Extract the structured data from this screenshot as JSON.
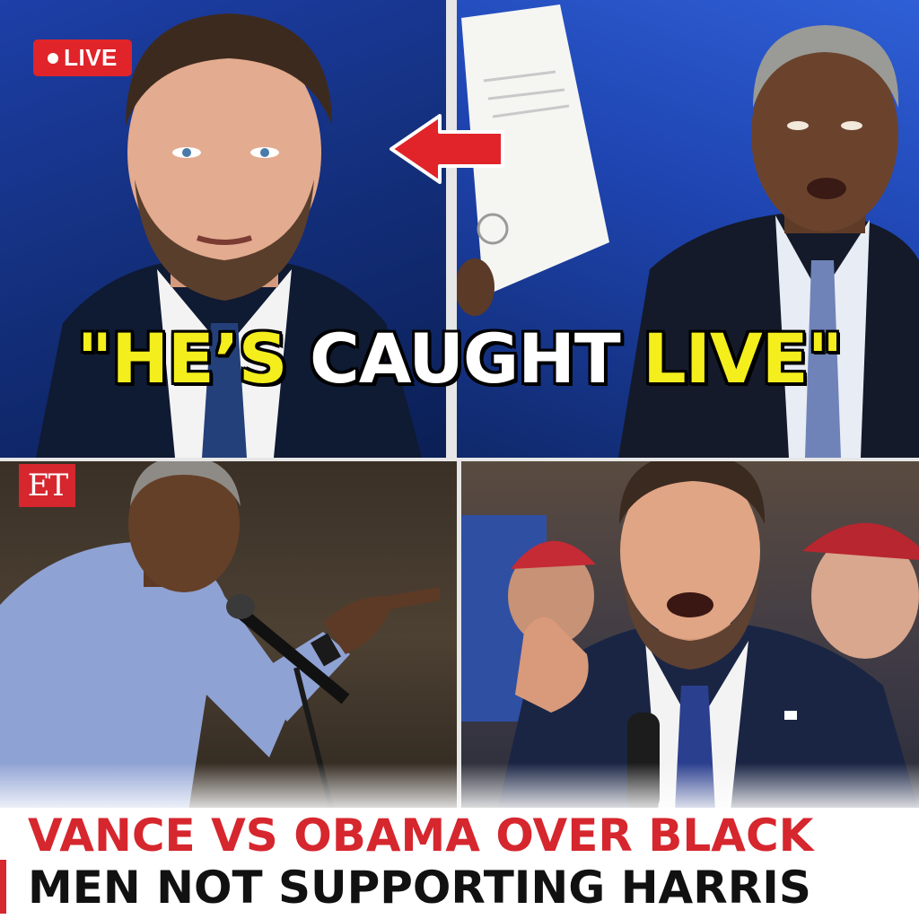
{
  "badge": {
    "live_label": "LIVE"
  },
  "overlay_quote": {
    "part1": "\"HE’S",
    "part2": "CAUGHT",
    "part3": "LIVE\""
  },
  "logo": {
    "text": "ET"
  },
  "headline": {
    "line1": "VANCE VS OBAMA OVER BLACK",
    "line2": "MEN NOT SUPPORTING HARRIS"
  },
  "colors": {
    "live_red": "#e0242a",
    "quote_yellow": "#f4ee1c",
    "headline_red": "#d6262e",
    "headline_black": "#111111"
  },
  "icons": {
    "arrow": "left-arrow-icon"
  }
}
